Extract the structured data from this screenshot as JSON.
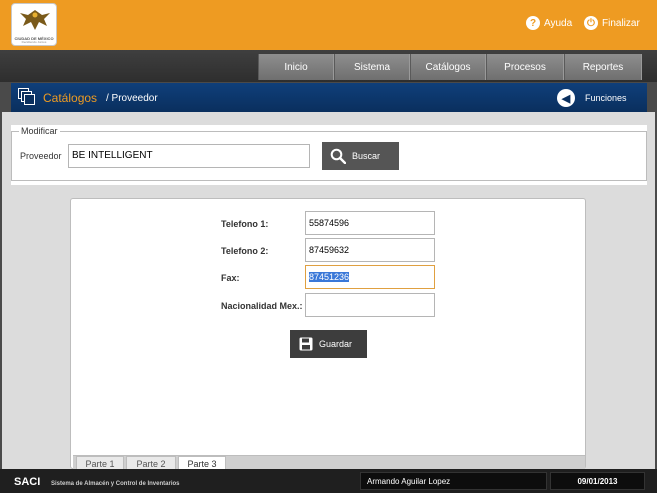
{
  "header": {
    "logo_text": "CIUDAD DE MÉXICO",
    "logo_sub": "Decidiendo Juntos",
    "help_label": "Ayuda",
    "logout_label": "Finalizar"
  },
  "nav": {
    "items": [
      {
        "label": "Inicio"
      },
      {
        "label": "Sistema"
      },
      {
        "label": "Catálogos"
      },
      {
        "label": "Procesos"
      },
      {
        "label": "Reportes"
      }
    ]
  },
  "breadcrumb": {
    "section": "Catálogos",
    "page": "/ Proveedor",
    "functions_label": "Funciones"
  },
  "modify": {
    "legend": "Modificar",
    "provider_label": "Proveedor",
    "provider_value": "BE INTELLIGENT",
    "search_label": "Buscar"
  },
  "form": {
    "phone1_label": "Telefono 1:",
    "phone1_value": "55874596",
    "phone2_label": "Telefono 2:",
    "phone2_value": "87459632",
    "fax_label": "Fax:",
    "fax_value": "87451236",
    "nationality_label": "Nacionalidad Mex.:",
    "nationality_value": "",
    "save_label": "Guardar"
  },
  "tabs": [
    {
      "label": "Parte 1"
    },
    {
      "label": "Parte 2"
    },
    {
      "label": "Parte 3",
      "active": true
    }
  ],
  "footer": {
    "app_name": "SACI",
    "app_subtitle": "Sistema de Almacén y Control de Inventarios",
    "user": "Armando Aguilar Lopez",
    "date": "09/01/2013"
  },
  "colors": {
    "header_orange": "#ee9b22",
    "bar_blue": "#0a2f5e",
    "selection_blue": "#3a78d8"
  }
}
